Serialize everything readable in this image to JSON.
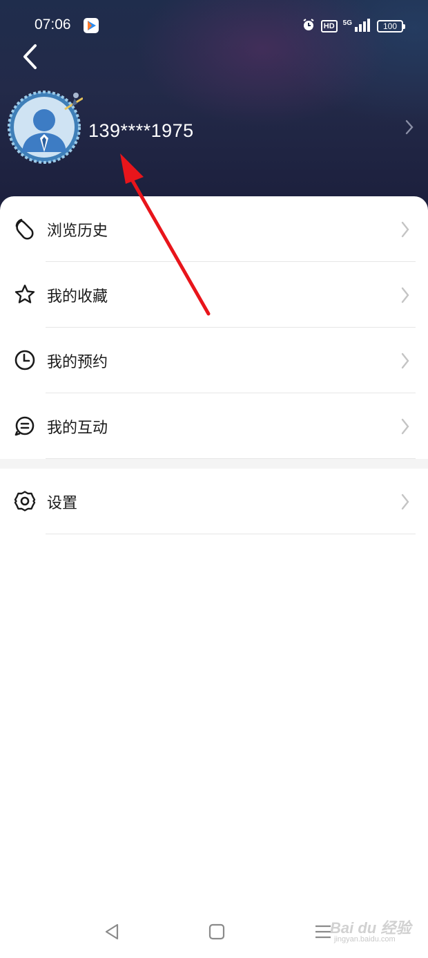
{
  "status_bar": {
    "time": "07:06",
    "network": "5G",
    "hd": "HD",
    "battery": "100",
    "icons": [
      "app-notification-icon",
      "alarm-icon",
      "hd-icon",
      "signal-icon",
      "battery-icon"
    ]
  },
  "header": {
    "back_icon": "chevron-left-icon",
    "username": "139****1975",
    "colors": {
      "header_bg": "#1f2a48",
      "text": "#ffffff"
    }
  },
  "menu": {
    "items": [
      {
        "label": "浏览历史",
        "icon": "history-icon"
      },
      {
        "label": "我的收藏",
        "icon": "star-icon"
      },
      {
        "label": "我的预约",
        "icon": "clock-icon"
      },
      {
        "label": "我的互动",
        "icon": "chat-icon"
      },
      {
        "label": "设置",
        "icon": "gear-icon"
      }
    ]
  },
  "nav_bar": {
    "icons": [
      "back-triangle-icon",
      "home-square-icon",
      "menu-lines-icon"
    ]
  },
  "watermark": {
    "brand": "Bai du 经验",
    "site": "jingyan.baidu.com"
  },
  "colors": {
    "annotation_arrow": "#e8151b",
    "divider": "#e6e6e6",
    "chevron": "#c4c4c4"
  }
}
